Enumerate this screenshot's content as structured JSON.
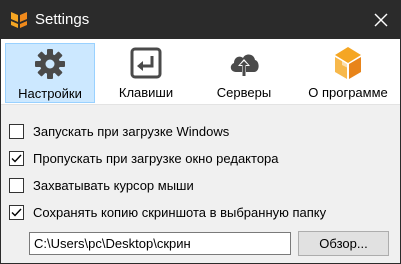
{
  "window": {
    "title": "Settings",
    "close_icon": "close-icon",
    "app_icon": "app-logo-icon"
  },
  "tabs": [
    {
      "label": "Настройки",
      "icon": "gear-icon",
      "selected": true
    },
    {
      "label": "Клавиши",
      "icon": "enter-key-icon",
      "selected": false
    },
    {
      "label": "Серверы",
      "icon": "cloud-upload-icon",
      "selected": false
    },
    {
      "label": "О программе",
      "icon": "app-logo-icon",
      "selected": false
    }
  ],
  "options": [
    {
      "label": "Запускать при загрузке Windows",
      "checked": false
    },
    {
      "label": "Пропускать при загрузке окно редактора",
      "checked": true
    },
    {
      "label": "Захватывать курсор мыши",
      "checked": false
    },
    {
      "label": "Сохранять копию скриншота в выбранную папку",
      "checked": true
    }
  ],
  "save_folder": {
    "value": "C:\\Users\\pc\\Desktop\\скрин",
    "browse_label": "Обзор..."
  },
  "colors": {
    "titlebar": "#2b2b2b",
    "accent": "#f5a623",
    "selected_tab_bg": "#cce8ff",
    "icon_gray": "#4a4a4a"
  }
}
